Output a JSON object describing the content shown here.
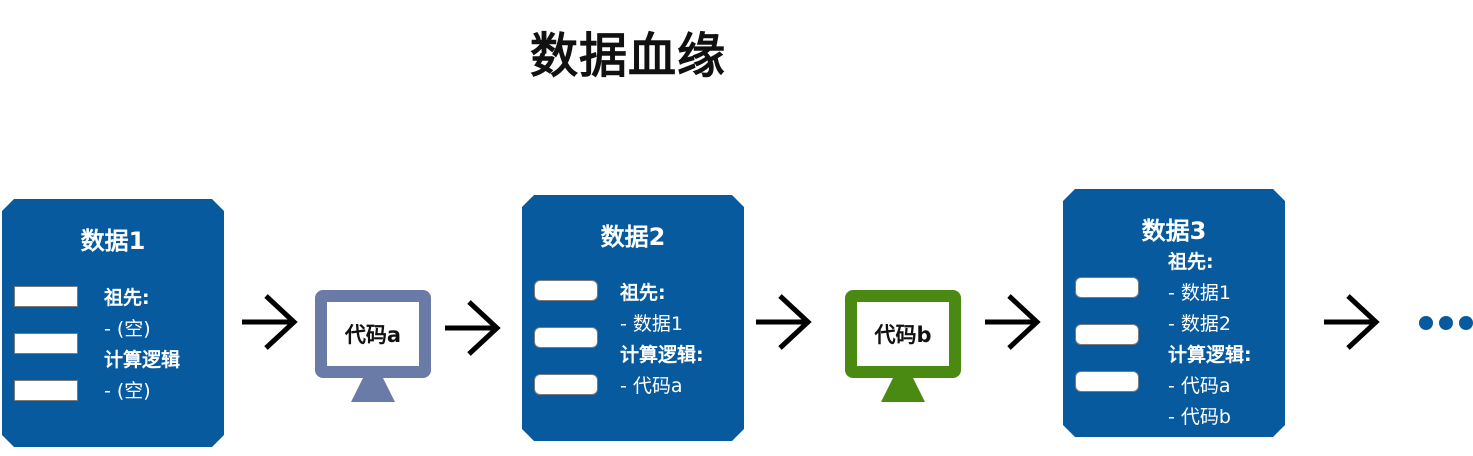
{
  "title": "数据血缘",
  "nodes": [
    {
      "name": "数据1",
      "ancestors_label": "祖先:",
      "ancestors": [
        "- (空)"
      ],
      "logic_label": "计算逻辑",
      "logic": [
        "- (空)"
      ]
    },
    {
      "name": "数据2",
      "ancestors_label": "祖先:",
      "ancestors": [
        "- 数据1"
      ],
      "logic_label": "计算逻辑:",
      "logic": [
        "- 代码a"
      ]
    },
    {
      "name": "数据3",
      "ancestors_label": "祖先:",
      "ancestors": [
        "- 数据1",
        "- 数据2"
      ],
      "logic_label": "计算逻辑:",
      "logic": [
        "- 代码a",
        "- 代码b"
      ]
    }
  ],
  "code_nodes": [
    {
      "label": "代码a",
      "color": "#6b7ba8"
    },
    {
      "label": "代码b",
      "color": "#4a8a13"
    }
  ],
  "colors": {
    "card": "#075a9e",
    "dots": "#075a9e",
    "arrow": "#000000"
  }
}
